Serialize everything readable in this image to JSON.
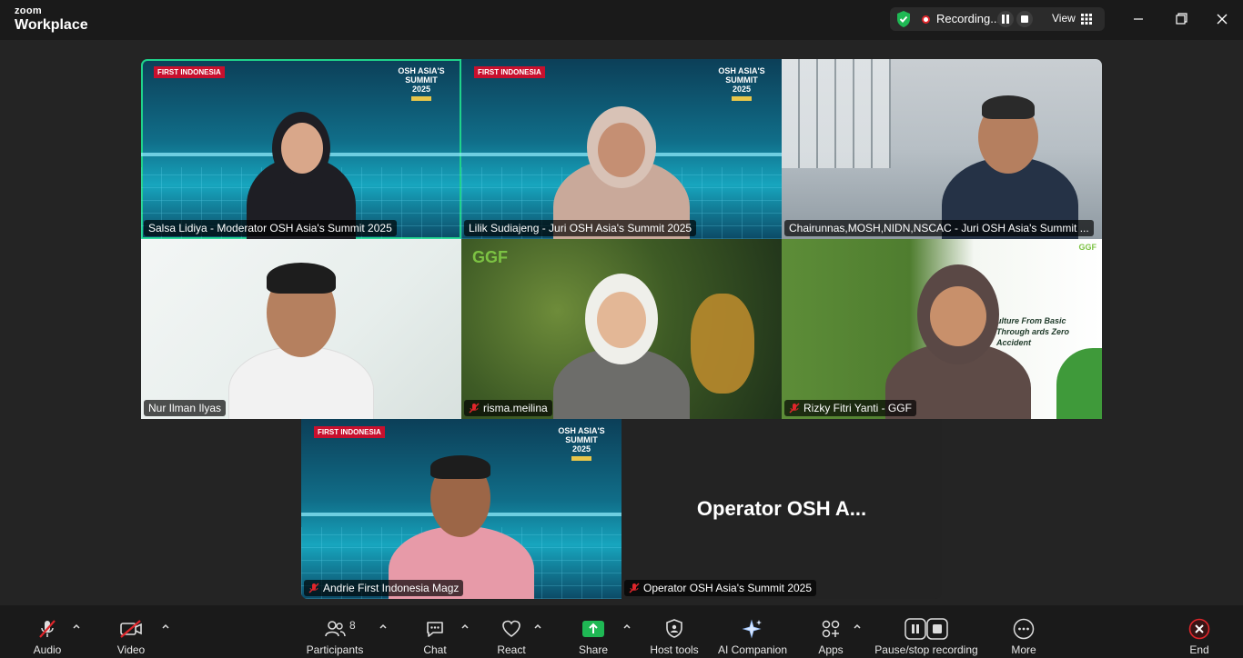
{
  "app": {
    "brand_top": "zoom",
    "brand_bottom": "Workplace"
  },
  "recording": {
    "text": "Recording...",
    "view_label": "View"
  },
  "tiles": [
    {
      "name": "Salsa Lidiya - Moderator OSH Asia's Summit 2025",
      "muted": false,
      "active": true
    },
    {
      "name": "Lilik Sudiajeng - Juri OSH Asia's Summit 2025",
      "muted": false,
      "active": false
    },
    {
      "name": "Chairunnas,MOSH,NIDN,NSCAC - Juri OSH Asia's Summit ...",
      "muted": false,
      "active": false
    },
    {
      "name": "Nur Ilman Ilyas",
      "muted": false,
      "active": false
    },
    {
      "name": "risma.meilina",
      "muted": true,
      "active": false
    },
    {
      "name": "Rizky Fitri Yanti - GGF",
      "muted": true,
      "active": false
    },
    {
      "name": "Andrie First Indonesia Magz",
      "muted": true,
      "active": false
    },
    {
      "name": "Operator OSH Asia's Summit 2025",
      "muted": true,
      "active": false,
      "display_name": "Operator OSH A..."
    }
  ],
  "backgrounds": {
    "first_indonesia": "FIRST INDONESIA",
    "osh_line1": "OSH ASIA'S",
    "osh_line2": "SUMMIT",
    "osh_line3": "2025",
    "ggf": "GGF",
    "ggf_slide": "ulture From Basic Through ards Zero Accident"
  },
  "toolbar": {
    "audio": "Audio",
    "video": "Video",
    "participants": "Participants",
    "participants_count": "8",
    "chat": "Chat",
    "react": "React",
    "share": "Share",
    "host_tools": "Host tools",
    "ai_companion": "AI Companion",
    "apps": "Apps",
    "pause_recording": "Pause/stop recording",
    "more": "More",
    "end": "End"
  },
  "colors": {
    "accent_green": "#1fd28a",
    "share_green": "#1fb854",
    "recording_red": "#e0262b",
    "end_red": "#e0262b"
  }
}
